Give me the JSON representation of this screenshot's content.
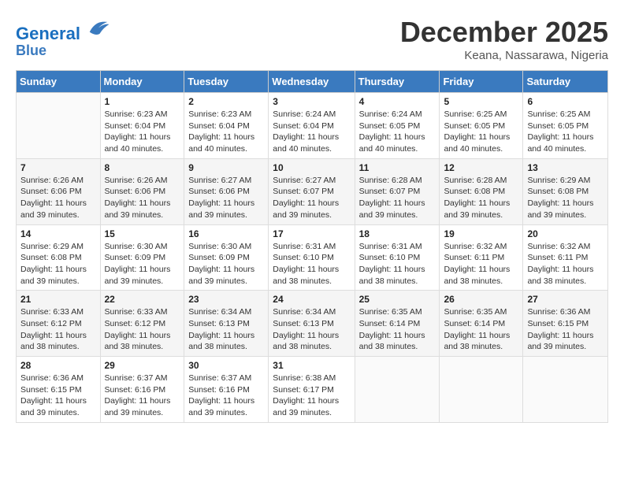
{
  "header": {
    "logo_line1": "General",
    "logo_line2": "Blue",
    "month_title": "December 2025",
    "location": "Keana, Nassarawa, Nigeria"
  },
  "weekdays": [
    "Sunday",
    "Monday",
    "Tuesday",
    "Wednesday",
    "Thursday",
    "Friday",
    "Saturday"
  ],
  "weeks": [
    [
      {
        "day": "",
        "sunrise": "",
        "sunset": "",
        "daylight": ""
      },
      {
        "day": "1",
        "sunrise": "Sunrise: 6:23 AM",
        "sunset": "Sunset: 6:04 PM",
        "daylight": "Daylight: 11 hours and 40 minutes."
      },
      {
        "day": "2",
        "sunrise": "Sunrise: 6:23 AM",
        "sunset": "Sunset: 6:04 PM",
        "daylight": "Daylight: 11 hours and 40 minutes."
      },
      {
        "day": "3",
        "sunrise": "Sunrise: 6:24 AM",
        "sunset": "Sunset: 6:04 PM",
        "daylight": "Daylight: 11 hours and 40 minutes."
      },
      {
        "day": "4",
        "sunrise": "Sunrise: 6:24 AM",
        "sunset": "Sunset: 6:05 PM",
        "daylight": "Daylight: 11 hours and 40 minutes."
      },
      {
        "day": "5",
        "sunrise": "Sunrise: 6:25 AM",
        "sunset": "Sunset: 6:05 PM",
        "daylight": "Daylight: 11 hours and 40 minutes."
      },
      {
        "day": "6",
        "sunrise": "Sunrise: 6:25 AM",
        "sunset": "Sunset: 6:05 PM",
        "daylight": "Daylight: 11 hours and 40 minutes."
      }
    ],
    [
      {
        "day": "7",
        "sunrise": "Sunrise: 6:26 AM",
        "sunset": "Sunset: 6:06 PM",
        "daylight": "Daylight: 11 hours and 39 minutes."
      },
      {
        "day": "8",
        "sunrise": "Sunrise: 6:26 AM",
        "sunset": "Sunset: 6:06 PM",
        "daylight": "Daylight: 11 hours and 39 minutes."
      },
      {
        "day": "9",
        "sunrise": "Sunrise: 6:27 AM",
        "sunset": "Sunset: 6:06 PM",
        "daylight": "Daylight: 11 hours and 39 minutes."
      },
      {
        "day": "10",
        "sunrise": "Sunrise: 6:27 AM",
        "sunset": "Sunset: 6:07 PM",
        "daylight": "Daylight: 11 hours and 39 minutes."
      },
      {
        "day": "11",
        "sunrise": "Sunrise: 6:28 AM",
        "sunset": "Sunset: 6:07 PM",
        "daylight": "Daylight: 11 hours and 39 minutes."
      },
      {
        "day": "12",
        "sunrise": "Sunrise: 6:28 AM",
        "sunset": "Sunset: 6:08 PM",
        "daylight": "Daylight: 11 hours and 39 minutes."
      },
      {
        "day": "13",
        "sunrise": "Sunrise: 6:29 AM",
        "sunset": "Sunset: 6:08 PM",
        "daylight": "Daylight: 11 hours and 39 minutes."
      }
    ],
    [
      {
        "day": "14",
        "sunrise": "Sunrise: 6:29 AM",
        "sunset": "Sunset: 6:08 PM",
        "daylight": "Daylight: 11 hours and 39 minutes."
      },
      {
        "day": "15",
        "sunrise": "Sunrise: 6:30 AM",
        "sunset": "Sunset: 6:09 PM",
        "daylight": "Daylight: 11 hours and 39 minutes."
      },
      {
        "day": "16",
        "sunrise": "Sunrise: 6:30 AM",
        "sunset": "Sunset: 6:09 PM",
        "daylight": "Daylight: 11 hours and 39 minutes."
      },
      {
        "day": "17",
        "sunrise": "Sunrise: 6:31 AM",
        "sunset": "Sunset: 6:10 PM",
        "daylight": "Daylight: 11 hours and 38 minutes."
      },
      {
        "day": "18",
        "sunrise": "Sunrise: 6:31 AM",
        "sunset": "Sunset: 6:10 PM",
        "daylight": "Daylight: 11 hours and 38 minutes."
      },
      {
        "day": "19",
        "sunrise": "Sunrise: 6:32 AM",
        "sunset": "Sunset: 6:11 PM",
        "daylight": "Daylight: 11 hours and 38 minutes."
      },
      {
        "day": "20",
        "sunrise": "Sunrise: 6:32 AM",
        "sunset": "Sunset: 6:11 PM",
        "daylight": "Daylight: 11 hours and 38 minutes."
      }
    ],
    [
      {
        "day": "21",
        "sunrise": "Sunrise: 6:33 AM",
        "sunset": "Sunset: 6:12 PM",
        "daylight": "Daylight: 11 hours and 38 minutes."
      },
      {
        "day": "22",
        "sunrise": "Sunrise: 6:33 AM",
        "sunset": "Sunset: 6:12 PM",
        "daylight": "Daylight: 11 hours and 38 minutes."
      },
      {
        "day": "23",
        "sunrise": "Sunrise: 6:34 AM",
        "sunset": "Sunset: 6:13 PM",
        "daylight": "Daylight: 11 hours and 38 minutes."
      },
      {
        "day": "24",
        "sunrise": "Sunrise: 6:34 AM",
        "sunset": "Sunset: 6:13 PM",
        "daylight": "Daylight: 11 hours and 38 minutes."
      },
      {
        "day": "25",
        "sunrise": "Sunrise: 6:35 AM",
        "sunset": "Sunset: 6:14 PM",
        "daylight": "Daylight: 11 hours and 38 minutes."
      },
      {
        "day": "26",
        "sunrise": "Sunrise: 6:35 AM",
        "sunset": "Sunset: 6:14 PM",
        "daylight": "Daylight: 11 hours and 38 minutes."
      },
      {
        "day": "27",
        "sunrise": "Sunrise: 6:36 AM",
        "sunset": "Sunset: 6:15 PM",
        "daylight": "Daylight: 11 hours and 39 minutes."
      }
    ],
    [
      {
        "day": "28",
        "sunrise": "Sunrise: 6:36 AM",
        "sunset": "Sunset: 6:15 PM",
        "daylight": "Daylight: 11 hours and 39 minutes."
      },
      {
        "day": "29",
        "sunrise": "Sunrise: 6:37 AM",
        "sunset": "Sunset: 6:16 PM",
        "daylight": "Daylight: 11 hours and 39 minutes."
      },
      {
        "day": "30",
        "sunrise": "Sunrise: 6:37 AM",
        "sunset": "Sunset: 6:16 PM",
        "daylight": "Daylight: 11 hours and 39 minutes."
      },
      {
        "day": "31",
        "sunrise": "Sunrise: 6:38 AM",
        "sunset": "Sunset: 6:17 PM",
        "daylight": "Daylight: 11 hours and 39 minutes."
      },
      {
        "day": "",
        "sunrise": "",
        "sunset": "",
        "daylight": ""
      },
      {
        "day": "",
        "sunrise": "",
        "sunset": "",
        "daylight": ""
      },
      {
        "day": "",
        "sunrise": "",
        "sunset": "",
        "daylight": ""
      }
    ]
  ]
}
